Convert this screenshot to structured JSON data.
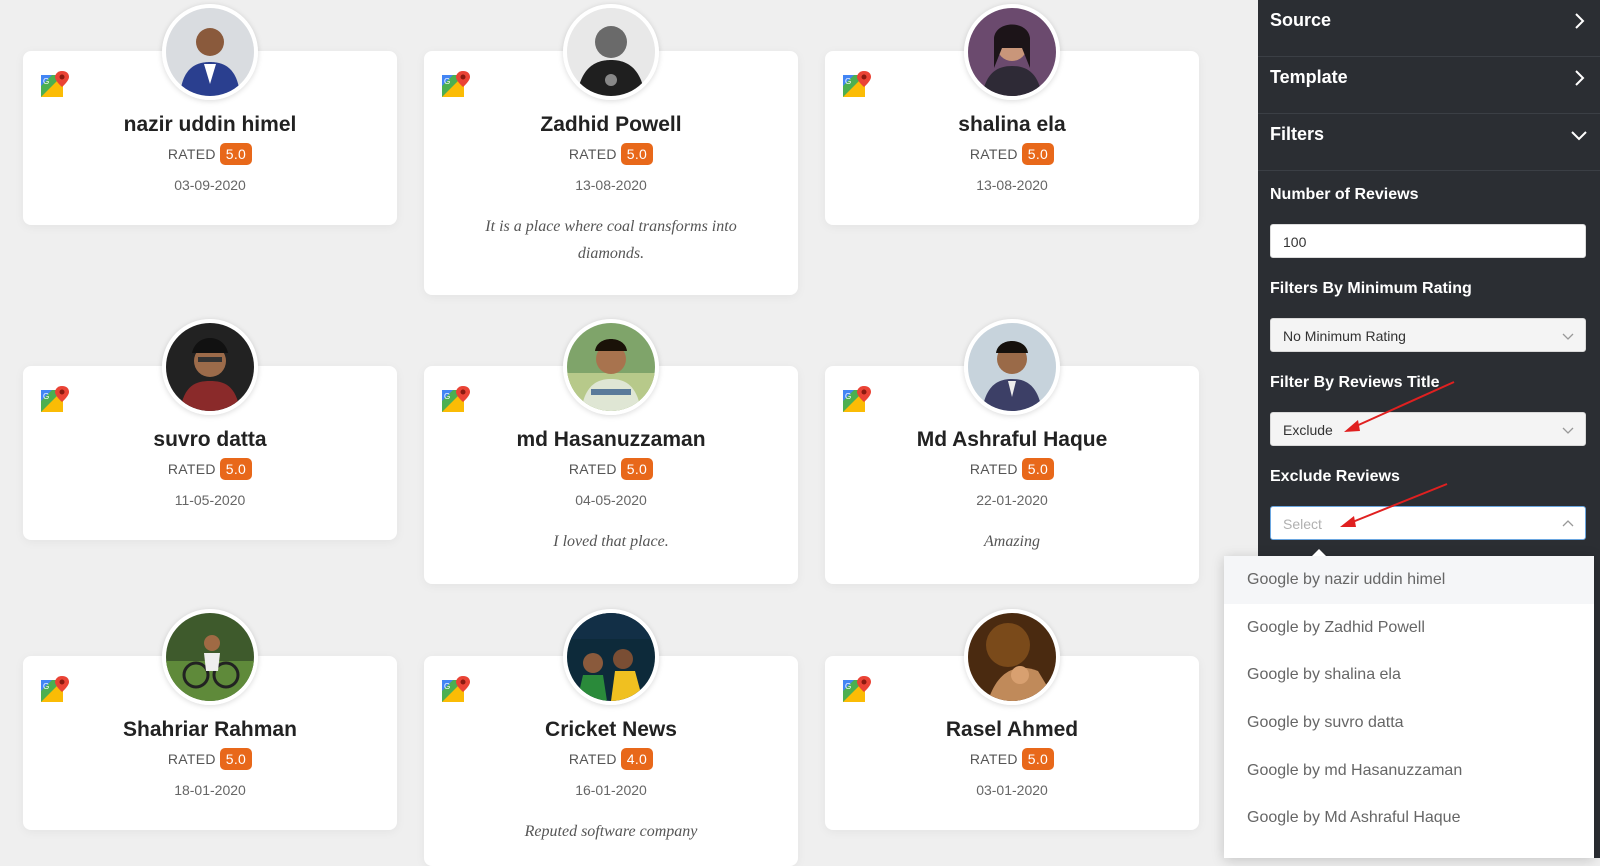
{
  "cards": [
    {
      "name": "nazir uddin himel",
      "rated_label": "RATED",
      "rating": "5.0",
      "date": "03-09-2020",
      "review": ""
    },
    {
      "name": "Zadhid Powell",
      "rated_label": "RATED",
      "rating": "5.0",
      "date": "13-08-2020",
      "review": "It is a place where coal transforms into diamonds."
    },
    {
      "name": "shalina ela",
      "rated_label": "RATED",
      "rating": "5.0",
      "date": "13-08-2020",
      "review": ""
    },
    {
      "name": "suvro datta",
      "rated_label": "RATED",
      "rating": "5.0",
      "date": "11-05-2020",
      "review": ""
    },
    {
      "name": "md Hasanuzzaman",
      "rated_label": "RATED",
      "rating": "5.0",
      "date": "04-05-2020",
      "review": "I loved that place."
    },
    {
      "name": "Md Ashraful Haque",
      "rated_label": "RATED",
      "rating": "5.0",
      "date": "22-01-2020",
      "review": "Amazing"
    },
    {
      "name": "Shahriar Rahman",
      "rated_label": "RATED",
      "rating": "5.0",
      "date": "18-01-2020",
      "review": ""
    },
    {
      "name": "Cricket News",
      "rated_label": "RATED",
      "rating": "4.0",
      "date": "16-01-2020",
      "review": "Reputed software company"
    },
    {
      "name": "Rasel Ahmed",
      "rated_label": "RATED",
      "rating": "5.0",
      "date": "03-01-2020",
      "review": ""
    }
  ],
  "panel": {
    "source_label": "Source",
    "template_label": "Template",
    "filters_label": "Filters",
    "num_reviews_label": "Number of Reviews",
    "num_reviews_value": "100",
    "min_rating_label": "Filters By Minimum Rating",
    "min_rating_value": "No Minimum Rating",
    "title_filter_label": "Filter By Reviews Title",
    "title_filter_value": "Exclude",
    "exclude_label": "Exclude Reviews",
    "exclude_placeholder": "Select"
  },
  "dropdown_options": [
    "Google by nazir uddin himel",
    "Google by Zadhid Powell",
    "Google by shalina ela",
    "Google by suvro datta",
    "Google by md Hasanuzzaman",
    "Google by Md Ashraful Haque"
  ],
  "colors": {
    "accent": "#e8681a",
    "panel_bg": "#2b2e33",
    "annotation_arrow": "#e02020"
  },
  "icons": {
    "source_icon": "google-maps-icon",
    "chevron": "chevron-right-icon"
  }
}
